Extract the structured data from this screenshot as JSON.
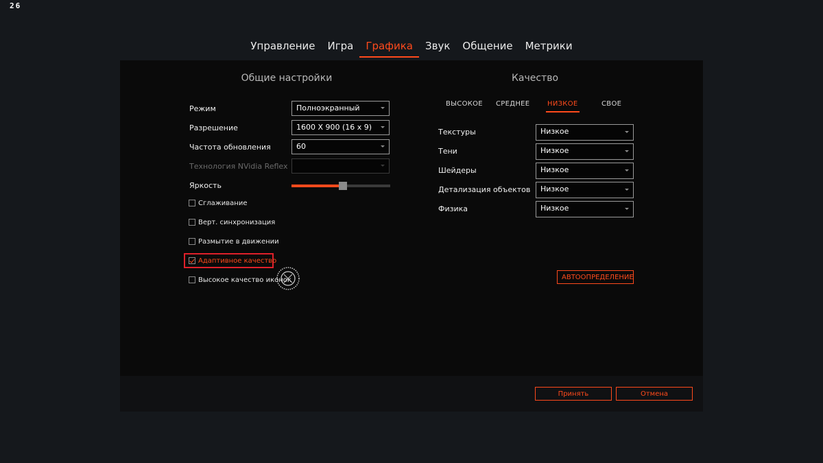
{
  "overlay": {
    "fps": "26"
  },
  "tabs": [
    {
      "label": "Управление",
      "active": false
    },
    {
      "label": "Игра",
      "active": false
    },
    {
      "label": "Графика",
      "active": true
    },
    {
      "label": "Звук",
      "active": false
    },
    {
      "label": "Общение",
      "active": false
    },
    {
      "label": "Метрики",
      "active": false
    }
  ],
  "general": {
    "title": "Общие настройки",
    "mode": {
      "label": "Режим",
      "value": "Полноэкранный"
    },
    "resolution": {
      "label": "Разрешение",
      "value": "1600 X 900 (16 x 9)"
    },
    "refresh": {
      "label": "Частота обновления",
      "value": "60"
    },
    "reflex": {
      "label": "Технология NVidia Reflex",
      "value": "",
      "disabled": true
    },
    "brightness": {
      "label": "Яркость",
      "level": 0.52
    },
    "checkboxes": {
      "antialiasing": {
        "label": "Сглаживание",
        "checked": false
      },
      "vsync": {
        "label": "Верт. синхронизация",
        "checked": false
      },
      "motion_blur": {
        "label": "Размытие в движении",
        "checked": false
      },
      "adaptive": {
        "label": "Адаптивное качество",
        "checked": true
      },
      "icons_hq": {
        "label": "Высокое качество иконок",
        "checked": false
      }
    }
  },
  "quality": {
    "title": "Качество",
    "presets": {
      "high": "ВЫСОКОЕ",
      "medium": "СРЕДНЕЕ",
      "low": "НИЗКОЕ",
      "custom": "СВОЕ",
      "active": "low"
    },
    "textures": {
      "label": "Текстуры",
      "value": "Низкое"
    },
    "shadows": {
      "label": "Тени",
      "value": "Низкое"
    },
    "shaders": {
      "label": "Шейдеры",
      "value": "Низкое"
    },
    "detail": {
      "label": "Детализация объектов",
      "value": "Низкое"
    },
    "physics": {
      "label": "Физика",
      "value": "Низкое"
    },
    "autodetect": "АВТООПРЕДЕЛЕНИЕ"
  },
  "footer": {
    "apply": "Принять",
    "cancel": "Отмена"
  },
  "colors": {
    "accent": "#ff4a1c",
    "highlight": "#e0202a",
    "panel": "#0a0a0a",
    "background": "#15181c"
  }
}
